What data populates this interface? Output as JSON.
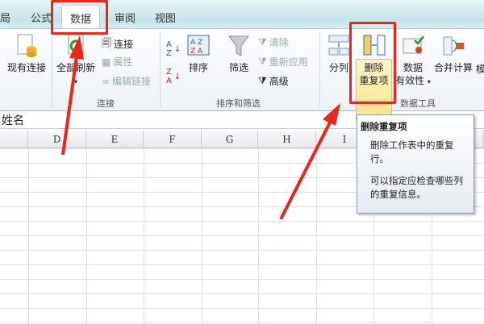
{
  "tabs": [
    {
      "label": "局"
    },
    {
      "label": "公式"
    },
    {
      "label": "数据",
      "active": true
    },
    {
      "label": "审阅"
    },
    {
      "label": "视图"
    }
  ],
  "ribbon": {
    "existing_connections": "现有连接",
    "refresh_all": "全部刷新",
    "connections": "连接",
    "properties": "属性",
    "edit_links": "编辑链接",
    "group_connections": "连接",
    "sort": "排序",
    "filter": "筛选",
    "clear": "清除",
    "reapply": "重新应用",
    "advanced": "高级",
    "group_sort_filter": "排序和筛选",
    "text_to_columns": "分列",
    "remove_duplicates_1": "删除",
    "remove_duplicates_2": "重复项",
    "data_validation_1": "数据",
    "data_validation_2": "有效性",
    "consolidate": "合并计算",
    "whatif": "模",
    "group_data_tools": "数据工具"
  },
  "formula_bar": {
    "value": "姓名"
  },
  "columns": [
    "D",
    "E",
    "F",
    "G",
    "H",
    "I"
  ],
  "tooltip": {
    "title": "删除重复项",
    "line1": "删除工作表中的重复行。",
    "line2": "可以指定应检查哪些列的重复信息。"
  },
  "colors": {
    "annotation": "#e8261c"
  }
}
